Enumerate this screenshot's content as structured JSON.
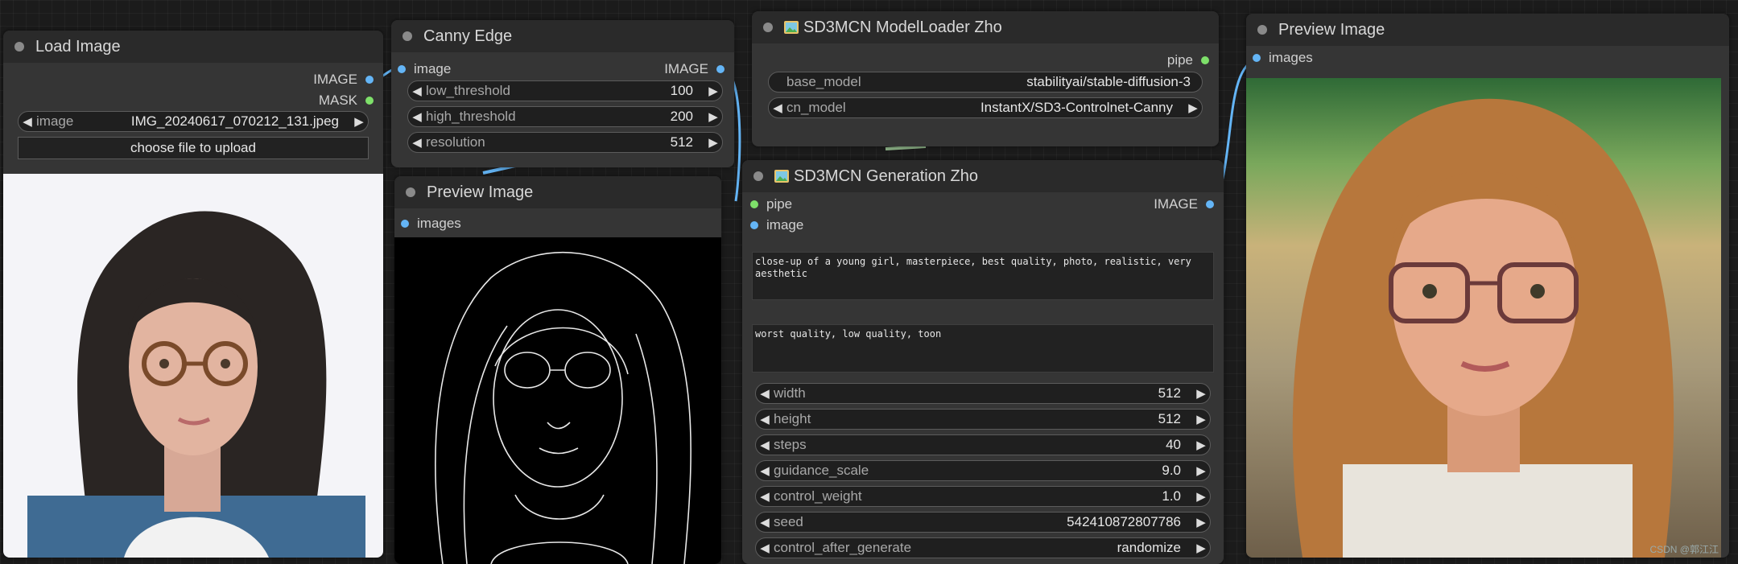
{
  "nodes": {
    "load_image": {
      "title": "Load Image",
      "outputs": [
        "IMAGE",
        "MASK"
      ],
      "image_widget": {
        "label": "image",
        "value": "IMG_20240617_070212_131.jpeg"
      },
      "upload_button": "choose file to upload"
    },
    "canny": {
      "title": "Canny Edge",
      "input": "image",
      "output": "IMAGE",
      "widgets": [
        {
          "label": "low_threshold",
          "value": "100"
        },
        {
          "label": "high_threshold",
          "value": "200"
        },
        {
          "label": "resolution",
          "value": "512"
        }
      ]
    },
    "preview_edge": {
      "title": "Preview Image",
      "input": "images"
    },
    "model_loader": {
      "title": "SD3MCN ModelLoader Zho",
      "output": "pipe",
      "widgets": [
        {
          "label": "base_model",
          "value": "stabilityai/stable-diffusion-3"
        },
        {
          "label": "cn_model",
          "value": "InstantX/SD3-Controlnet-Canny"
        }
      ]
    },
    "generation": {
      "title": "SD3MCN Generation Zho",
      "inputs": [
        "pipe",
        "image"
      ],
      "output": "IMAGE",
      "positive_prompt": "close-up of a young girl, masterpiece, best quality, photo, realistic, very\naesthetic",
      "negative_prompt": "worst quality, low quality, toon",
      "widgets": [
        {
          "label": "width",
          "value": "512"
        },
        {
          "label": "height",
          "value": "512"
        },
        {
          "label": "steps",
          "value": "40"
        },
        {
          "label": "guidance_scale",
          "value": "9.0"
        },
        {
          "label": "control_weight",
          "value": "1.0"
        },
        {
          "label": "seed",
          "value": "542410872807786"
        },
        {
          "label": "control_after_generate",
          "value": "randomize"
        }
      ]
    },
    "preview_result": {
      "title": "Preview Image",
      "input": "images"
    }
  },
  "watermark": "CSDN @郭江江",
  "colors": {
    "canvas": "#1b1b1b",
    "node_body": "#353535",
    "node_header": "#2a2a2a",
    "image_slot": "#64b5f6",
    "pipe_slot": "#7ee06a"
  }
}
